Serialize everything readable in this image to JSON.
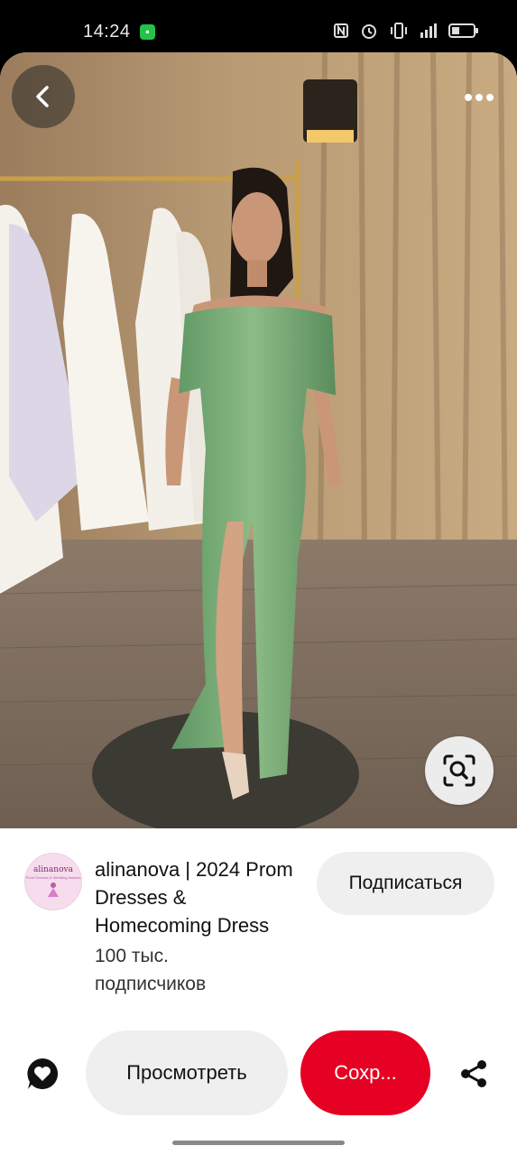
{
  "status_bar": {
    "time": "14:24",
    "icons": [
      "app-notification-icon",
      "nfc-icon",
      "alarm-icon",
      "vibrate-icon",
      "signal-icon",
      "battery-icon"
    ]
  },
  "photo": {
    "description_icons": [
      "back-arrow-icon",
      "more-dots-icon",
      "visual-search-icon"
    ]
  },
  "creator": {
    "name": "alinanova | 2024 Prom Dresses & Homecoming Dress",
    "followers": "100 тыс. подписчиков",
    "avatar_text": "alinanova",
    "avatar_subtext": "Prom Dresses & Wedding dresses",
    "follow_label": "Подписаться"
  },
  "actions": {
    "view_label": "Просмотреть",
    "save_label": "Сохр...",
    "save_color": "#e60023"
  }
}
